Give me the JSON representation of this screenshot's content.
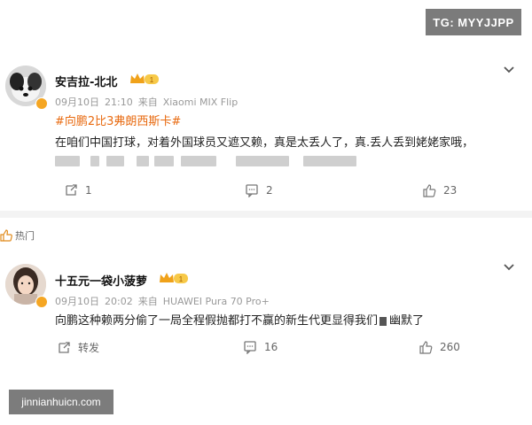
{
  "watermark_top": "TG: MYYJJPP",
  "watermark_bottom": "jinnianhuicn.com",
  "hot_label": "热门",
  "colors": {
    "topic": "#e86a10",
    "meta": "#999999",
    "badge": "#f5a623"
  },
  "posts": [
    {
      "username": "安吉拉-北北",
      "level": "1",
      "date": "09月10日",
      "time": "21:10",
      "source_prefix": "来自",
      "device": "Xiaomi MIX Flip",
      "topic": "#向鹏2比3弗朗西斯卡#",
      "content": "在咱们中国打球，对着外国球员又遮又赖，真是太丢人了，真.丢人丢到姥姥家哦，",
      "actions": {
        "repost": "1",
        "comment": "2",
        "like": "23"
      }
    },
    {
      "username": "十五元一袋小菠萝",
      "level": "1",
      "date": "09月10日",
      "time": "20:02",
      "source_prefix": "来自",
      "device": "HUAWEI Pura 70 Pro+",
      "content": "向鹏这种赖两分偷了一局全程假抛都打不赢的新生代更显得我们",
      "content_tail": "幽默了",
      "actions": {
        "repost": "转发",
        "comment": "16",
        "like": "260"
      }
    }
  ]
}
